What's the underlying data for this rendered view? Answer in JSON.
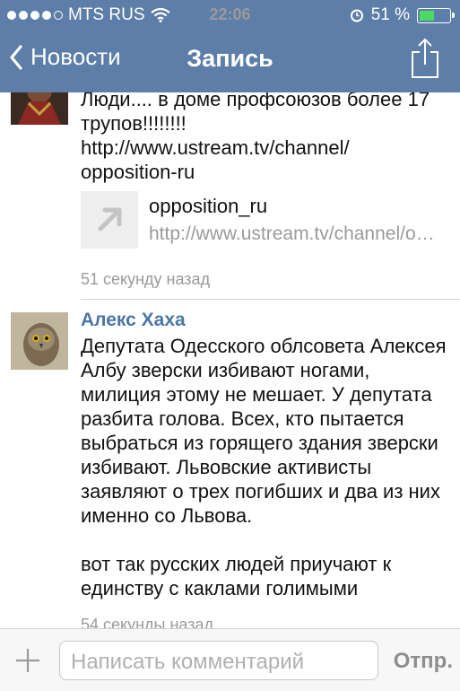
{
  "status_bar": {
    "carrier": "MTS RUS",
    "time": "22:06",
    "battery": "51 %",
    "battery_level": 0.51
  },
  "nav": {
    "back_label": "Новости",
    "title": "Запись"
  },
  "posts": [
    {
      "text": "Люди.... в доме профсоюзов более 17 трупов!!!!!!!!\nhttp://www.ustream.tv/channel/\nopposition-ru",
      "link": {
        "title": "opposition_ru",
        "url": "http://www.ustream.tv/channel/opposition-ru"
      },
      "time": "51 секунду назад"
    },
    {
      "author": "Алекс Хаха",
      "text": "Депутата Одесского облсовета Алексея Албу зверски избивают ногами, милиция этому не мешает. У депутата разбита голова. Всех, кто пытается выбраться из горящего здания зверски избивают. Львовские активисты заявляют о трех погибших и два из них именно со Львова.\n\nвот так русских людей приучают к единству с каклами голимыми",
      "time": "54 секунды назад"
    }
  ],
  "composer": {
    "placeholder": "Написать комментарий",
    "send_label": "Отпр."
  }
}
